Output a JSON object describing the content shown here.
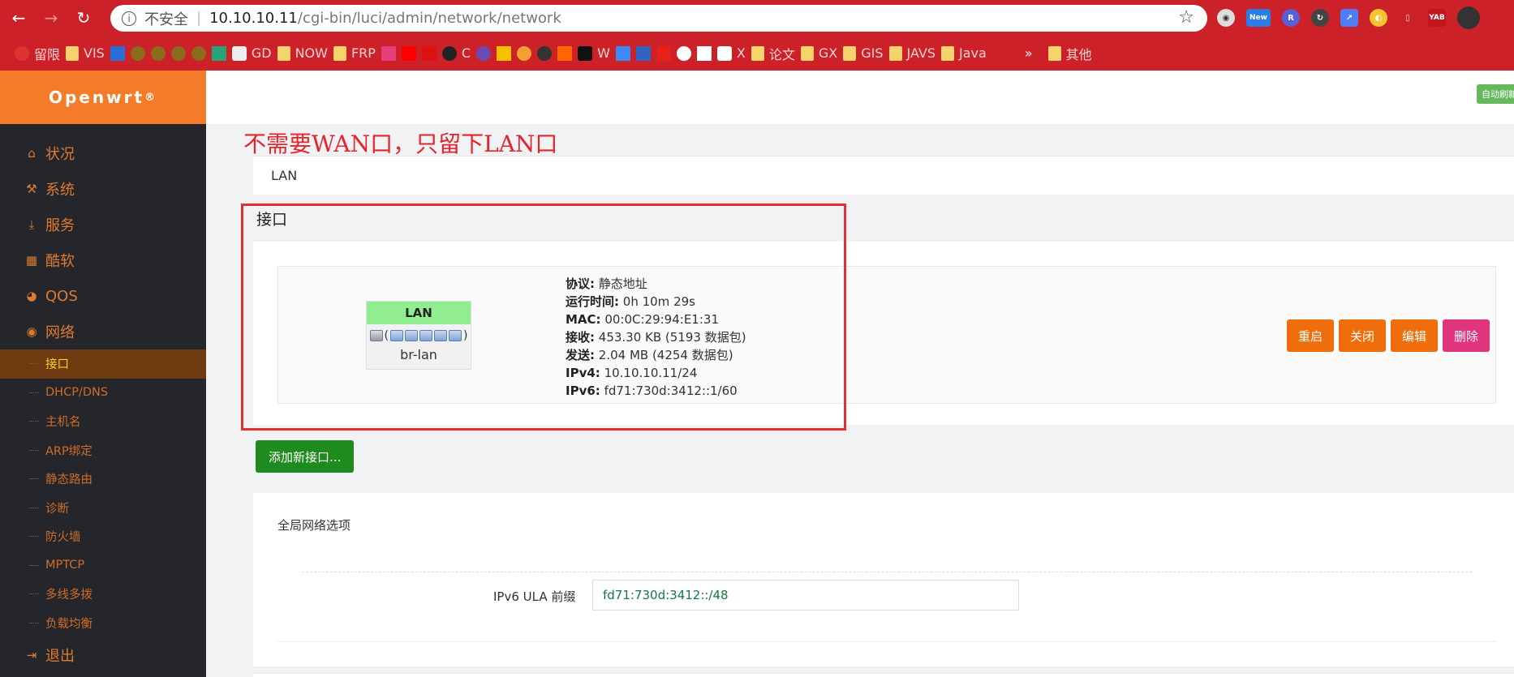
{
  "browser": {
    "security_label": "不安全",
    "url_host": "10.10.10.11",
    "url_path": "/cgi-bin/luci/admin/network/network",
    "nav_icons": [
      "back-icon",
      "forward-icon",
      "reload-icon"
    ],
    "ext_new_badge": "New",
    "ext_yab": "YAB",
    "bookmarks": [
      "留限",
      "VIS",
      "GD",
      "NOW",
      "FRP",
      "C",
      "W",
      "X",
      "论文",
      "GX",
      "GIS",
      "JAVS",
      "Java",
      "»",
      "其他"
    ]
  },
  "sidebar": {
    "brand": "Openwrt",
    "brand_mark": "®",
    "items": [
      {
        "label": "状况",
        "icon": "home-icon"
      },
      {
        "label": "系统",
        "icon": "wrench-icon"
      },
      {
        "label": "服务",
        "icon": "download-icon"
      },
      {
        "label": "酷软",
        "icon": "calendar-icon"
      },
      {
        "label": "QOS",
        "icon": "gauge-icon"
      },
      {
        "label": "网络",
        "icon": "globe-icon"
      }
    ],
    "sub_items": [
      "接口",
      "DHCP/DNS",
      "主机名",
      "ARP绑定",
      "静态路由",
      "诊断",
      "防火墙",
      "MPTCP",
      "多线多拨",
      "负载均衡"
    ],
    "logout": "退出"
  },
  "topbar": {
    "auto_refresh": "自动刷新"
  },
  "annotation": "不需要WAN口，只留下LAN口",
  "tabs": {
    "lan": "LAN"
  },
  "interfaces": {
    "title": "接口",
    "iface": {
      "name": "LAN",
      "device": "br-lan",
      "ports_open": "(",
      "ports_close": ")",
      "protocol_label": "协议:",
      "protocol": "静态地址",
      "uptime_label": "运行时间:",
      "uptime": "0h 10m 29s",
      "mac_label": "MAC:",
      "mac": "00:0C:29:94:E1:31",
      "rx_label": "接收:",
      "rx": "453.30 KB (5193 数据包)",
      "tx_label": "发送:",
      "tx": "2.04 MB (4254 数据包)",
      "ipv4_label": "IPv4:",
      "ipv4": "10.10.10.11/24",
      "ipv6_label": "IPv6:",
      "ipv6": "fd71:730d:3412::1/60"
    },
    "buttons": {
      "restart": "重启",
      "stop": "关闭",
      "edit": "编辑",
      "delete": "删除"
    },
    "add": "添加新接口..."
  },
  "global": {
    "title": "全局网络选项",
    "ula_label": "IPv6 ULA 前缀",
    "ula_value": "fd71:730d:3412::/48"
  }
}
